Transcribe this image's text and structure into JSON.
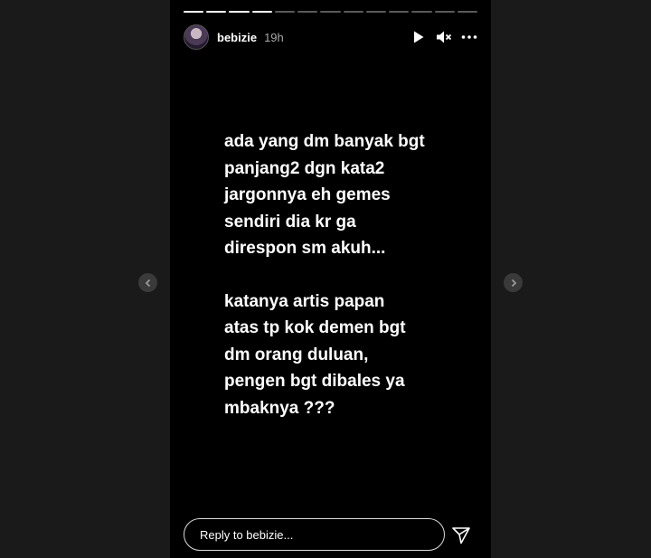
{
  "story": {
    "username": "bebizie",
    "time_ago": "19h",
    "segments_total": 13,
    "segments_complete": 4,
    "text_paragraphs": [
      [
        "ada yang dm banyak bgt",
        "panjang2 dgn kata2",
        "jargonnya eh gemes",
        "sendiri dia kr ga",
        "direspon sm akuh..."
      ],
      [
        "katanya artis papan",
        "atas tp kok demen bgt",
        "dm orang duluan,",
        "pengen bgt dibales ya",
        "mbaknya ???"
      ]
    ]
  },
  "reply": {
    "placeholder": "Reply to bebizie..."
  },
  "icons": {
    "play": "play-icon",
    "mute": "mute-icon",
    "more": "more-options-icon",
    "send": "send-icon",
    "prev": "chevron-left-icon",
    "next": "chevron-right-icon"
  }
}
